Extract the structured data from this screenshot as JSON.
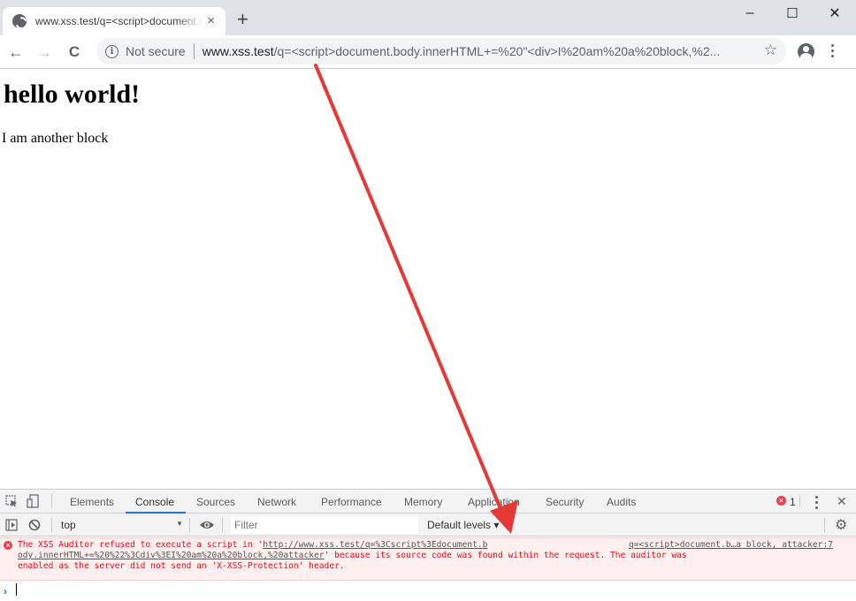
{
  "browser": {
    "tab": {
      "title": "www.xss.test/q=<script>document.body.innerHTML+=",
      "close_icon": "×"
    },
    "new_tab_icon": "+",
    "window_controls": {
      "minimize": "–",
      "maximize": "☐",
      "close": "✕"
    },
    "nav": {
      "back": "←",
      "forward": "→",
      "reload": "C"
    },
    "omnibox": {
      "security_label": "Not secure",
      "host": "www.xss.test",
      "path": "/q=<script>document.body.innerHTML+=%20\"<div>I%20am%20a%20block,%2...",
      "bookmark_icon": "☆"
    }
  },
  "page": {
    "heading": "hello world!",
    "paragraph": "I am another block"
  },
  "devtools": {
    "tabs": [
      {
        "label": "Elements"
      },
      {
        "label": "Console",
        "active": true
      },
      {
        "label": "Sources"
      },
      {
        "label": "Network"
      },
      {
        "label": "Performance"
      },
      {
        "label": "Memory"
      },
      {
        "label": "Application"
      },
      {
        "label": "Security"
      },
      {
        "label": "Audits"
      }
    ],
    "error_count": "1",
    "close_icon": "✕",
    "context": "top",
    "filter_placeholder": "Filter",
    "levels_label": "Default levels ▾",
    "console_message": {
      "level": "error",
      "text_before": "The XSS Auditor refused to execute a script in '",
      "url_line1": "http://www.xss.test/q=%3Cscript%3Edocument.b",
      "url_line2": "ody.innerHTML+=%20%22%3Cdiv%3EI%20am%20a%20block,%20attacker",
      "text_after_line2": "' because its source code was found within the request. The auditor was",
      "line3": "enabled as the server did not send an 'X-XSS-Protection' header.",
      "source_link": "q=<script>document.b…a block, attacker:7"
    },
    "prompt_icon": "›"
  },
  "annotation": {
    "arrow_color": "#e53935"
  }
}
